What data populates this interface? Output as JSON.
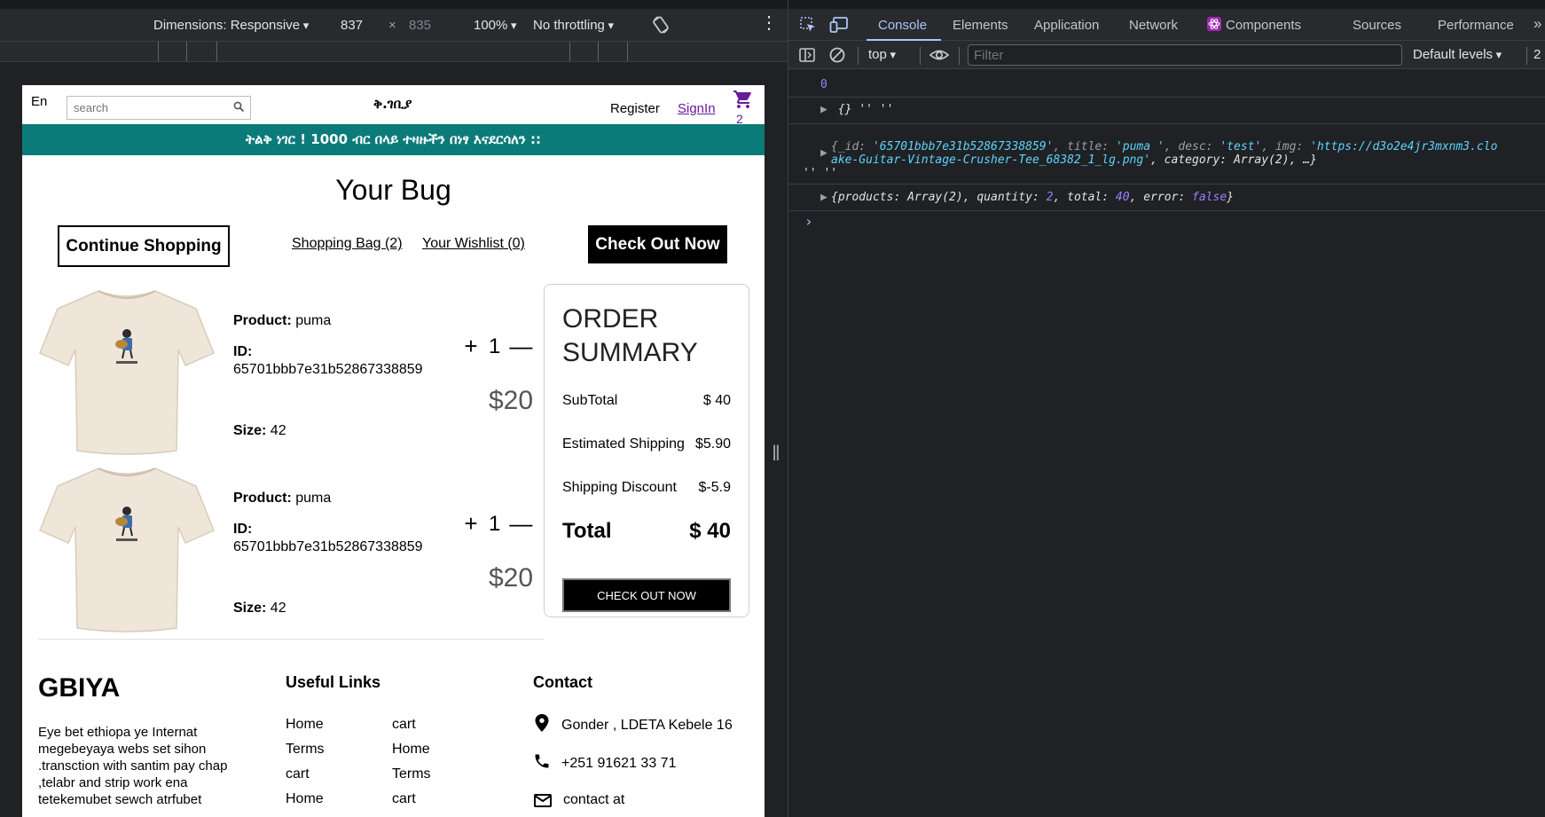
{
  "device_toolbar": {
    "dimensions": "Dimensions: Responsive",
    "width": "837",
    "times": "×",
    "height": "835",
    "zoom": "100%",
    "throttling": "No throttling"
  },
  "navbar": {
    "lang": "En",
    "search_placeholder": "search",
    "logo": "ቅ.ገቢያ",
    "register": "Register",
    "signin": "SignIn",
    "cart_count": "2"
  },
  "announcement": "ትልቅ ነገር ! 1000 ብር በላይ ተዛዙችን በነፃ እናደርሳለን ::",
  "cart": {
    "title": "Your Bug",
    "continue_label": "Continue Shopping",
    "bag_link": "Shopping Bag (2)",
    "wishlist_link": "Your Wishlist (0)",
    "checkout_top": "Check Out Now",
    "labels": {
      "product": "Product:",
      "id": "ID:",
      "size": "Size:"
    },
    "items": [
      {
        "name": "puma",
        "id": "65701bbb7e31b52867338859",
        "size": "42",
        "qty": "1",
        "price": "$20",
        "plus": "+",
        "minus": "—"
      },
      {
        "name": "puma",
        "id": "65701bbb7e31b52867338859",
        "size": "42",
        "qty": "1",
        "price": "$20",
        "plus": "+",
        "minus": "—"
      }
    ]
  },
  "summary": {
    "title_line1": "ORDER",
    "title_line2": "SUMMARY",
    "rows": [
      {
        "label": "SubTotal",
        "value": "$ 40"
      },
      {
        "label": "Estimated Shipping",
        "value": "$5.90"
      },
      {
        "label": "Shipping Discount",
        "value": "$-5.9"
      }
    ],
    "total_label": "Total",
    "total_value": "$ 40",
    "checkout": "CHECK OUT NOW"
  },
  "footer": {
    "brand": "GBIYA",
    "description": "Eye bet ethiopa ye Internat megebeyaya webs set sihon .transction with santim pay chap ,telabr and strip work ena tetekemubet sewch atrfubet",
    "links_title": "Useful Links",
    "links": [
      "Home",
      "cart",
      "Terms",
      "Home",
      "cart",
      "Terms",
      "Home",
      "cart"
    ],
    "contact_title": "Contact",
    "address": "Gonder , LDETA Kebele 16",
    "phone": "+251 91621 33 71",
    "email": "contact at"
  },
  "devtools": {
    "tabs": [
      "Console",
      "Elements",
      "Application",
      "Network",
      "Components",
      "Sources",
      "Performance"
    ],
    "context": "top",
    "filter_placeholder": "Filter",
    "levels": "Default levels",
    "issues": "2",
    "logs": {
      "zero": "0",
      "empty_obj": "{}",
      "empty_str": "'' ''",
      "obj_open": "{_id: ",
      "obj_id": "'65701bbb7e31b52867338859'",
      "obj_title_k": ", title: ",
      "obj_title": "'puma '",
      "obj_desc_k": ", desc: ",
      "obj_desc": "'test'",
      "obj_img_k": ", img: ",
      "obj_img": "'https://d3o2e4jr3mxnm3.clo",
      "obj_line2": "ake-Guitar-Vintage-Crusher-Tee_68382_1_lg.png'",
      "obj_line2_rest": ", category: Array(2), …}",
      "obj_trailer": "'' ''",
      "state_open": "{products: Array(2), quantity: ",
      "state_qty": "2",
      "state_total_k": ", total: ",
      "state_total": "40",
      "state_err_k": ", error: ",
      "state_err": "false",
      "state_close": "}"
    }
  }
}
